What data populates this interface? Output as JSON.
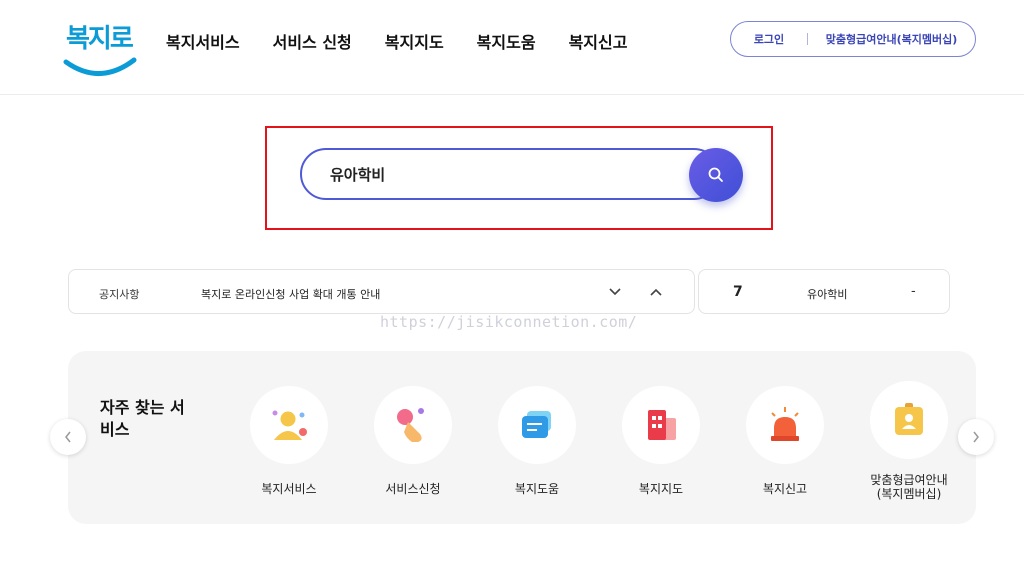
{
  "brand": {
    "logo_text": "복지로"
  },
  "nav": {
    "items": [
      {
        "label": "복지서비스"
      },
      {
        "label": "서비스 신청"
      },
      {
        "label": "복지지도"
      },
      {
        "label": "복지도움"
      },
      {
        "label": "복지신고"
      }
    ]
  },
  "header": {
    "login_label": "로그인",
    "membership_label": "맞춤형급여안내(복지멤버십)"
  },
  "search": {
    "value": "유아학비",
    "button_icon": "search-icon"
  },
  "notice": {
    "label": "공지사항",
    "text": "복지로 온라인신청 사업 확대 개통 안내"
  },
  "popular": {
    "rank": "7",
    "term": "유아학비",
    "change": "-"
  },
  "watermark": "https://jisikconnetion.com/",
  "frequent": {
    "title": "자주 찾는 서비스",
    "services": [
      {
        "label": "복지서비스",
        "icon": "person-icon"
      },
      {
        "label": "서비스신청",
        "icon": "hand-click-icon"
      },
      {
        "label": "복지도움",
        "icon": "chat-bubble-icon"
      },
      {
        "label": "복지지도",
        "icon": "building-icon"
      },
      {
        "label": "복지신고",
        "icon": "siren-icon"
      },
      {
        "label": "맞춤형급여안내\n(복지멤버십)",
        "icon": "id-card-icon"
      }
    ]
  },
  "colors": {
    "brand_blue": "#0b9bd6",
    "accent_purple": "#4f5ad6",
    "highlight_red": "#e3121b"
  }
}
